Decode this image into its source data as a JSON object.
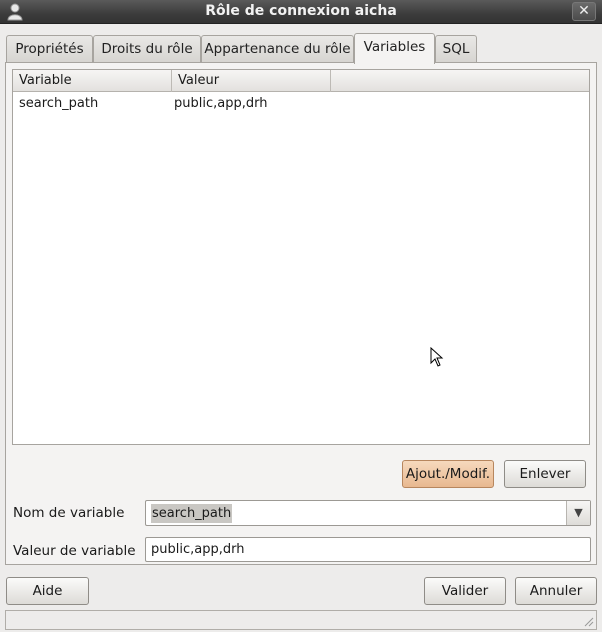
{
  "window": {
    "title": "Rôle de connexion aicha",
    "close_glyph": "✕"
  },
  "tabs": [
    {
      "label": "Propriétés"
    },
    {
      "label": "Droits du rôle"
    },
    {
      "label": "Appartenance du rôle"
    },
    {
      "label": "Variables",
      "active": true
    },
    {
      "label": "SQL"
    }
  ],
  "table": {
    "columns": [
      "Variable",
      "Valeur"
    ],
    "rows": [
      {
        "variable": "search_path",
        "valeur": "public,app,drh"
      }
    ]
  },
  "buttons": {
    "add_modify": "Ajout./Modif.",
    "remove": "Enlever",
    "help": "Aide",
    "ok": "Valider",
    "cancel": "Annuler"
  },
  "form": {
    "name_label": "Nom de variable",
    "name_value": "search_path",
    "value_label": "Valeur de variable",
    "value_value": "public,app,drh"
  },
  "icons": {
    "app": "user-icon",
    "close": "close-icon",
    "dropdown": "chevron-down-icon",
    "grip": "resize-grip-icon",
    "cursor": "mouse-pointer-icon"
  }
}
